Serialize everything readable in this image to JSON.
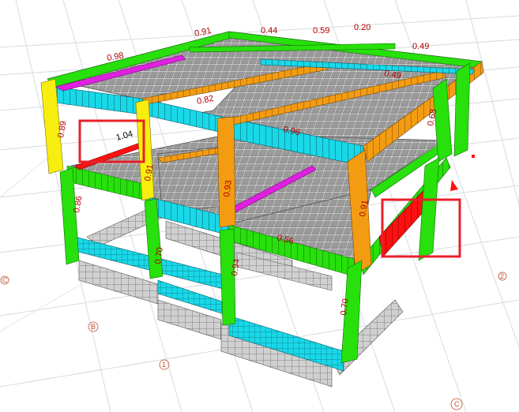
{
  "view": "3D structural model — member stress ratio colours",
  "colors": {
    "background": "#ffffff",
    "grid": "#d6dbe0",
    "slab": "#8c8c8c",
    "slab_mesh": "#ffffff",
    "foundation": "#c8c8c8",
    "ratio_low": "#9bd9f0",
    "cyan": "#19d8e8",
    "green": "#27e00c",
    "yellow": "#f7ee10",
    "orange": "#f39c12",
    "red": "#ff1010",
    "magenta": "#e020e0",
    "label": "#b00000",
    "highlight_box": "#e8202a"
  },
  "ratio_labels": [
    {
      "id": "r1",
      "text": "0.91"
    },
    {
      "id": "r2",
      "text": "0.44"
    },
    {
      "id": "r3",
      "text": "0.59"
    },
    {
      "id": "r4",
      "text": "0.20"
    },
    {
      "id": "r5",
      "text": "0.98"
    },
    {
      "id": "r6",
      "text": "0.49"
    },
    {
      "id": "r7",
      "text": "0.82"
    },
    {
      "id": "r8",
      "text": "1.04"
    },
    {
      "id": "r9",
      "text": "0.89"
    },
    {
      "id": "r10",
      "text": "0.91"
    },
    {
      "id": "r11",
      "text": "0.91"
    },
    {
      "id": "r12",
      "text": "0.70"
    },
    {
      "id": "r13",
      "text": "0.93"
    },
    {
      "id": "r14",
      "text": "0.86"
    },
    {
      "id": "r15",
      "text": "0.56"
    },
    {
      "id": "r16",
      "text": "0.96"
    },
    {
      "id": "r17",
      "text": "0.70"
    },
    {
      "id": "r18",
      "text": "0.94"
    },
    {
      "id": "r19",
      "text": "0.68"
    },
    {
      "id": "r20",
      "text": "0.49"
    }
  ],
  "grid_bubbles": [
    {
      "id": "b1",
      "text": "C"
    },
    {
      "id": "b2",
      "text": "B"
    },
    {
      "id": "b3",
      "text": "1"
    },
    {
      "id": "b4",
      "text": "C"
    },
    {
      "id": "b5",
      "text": "2"
    }
  ]
}
